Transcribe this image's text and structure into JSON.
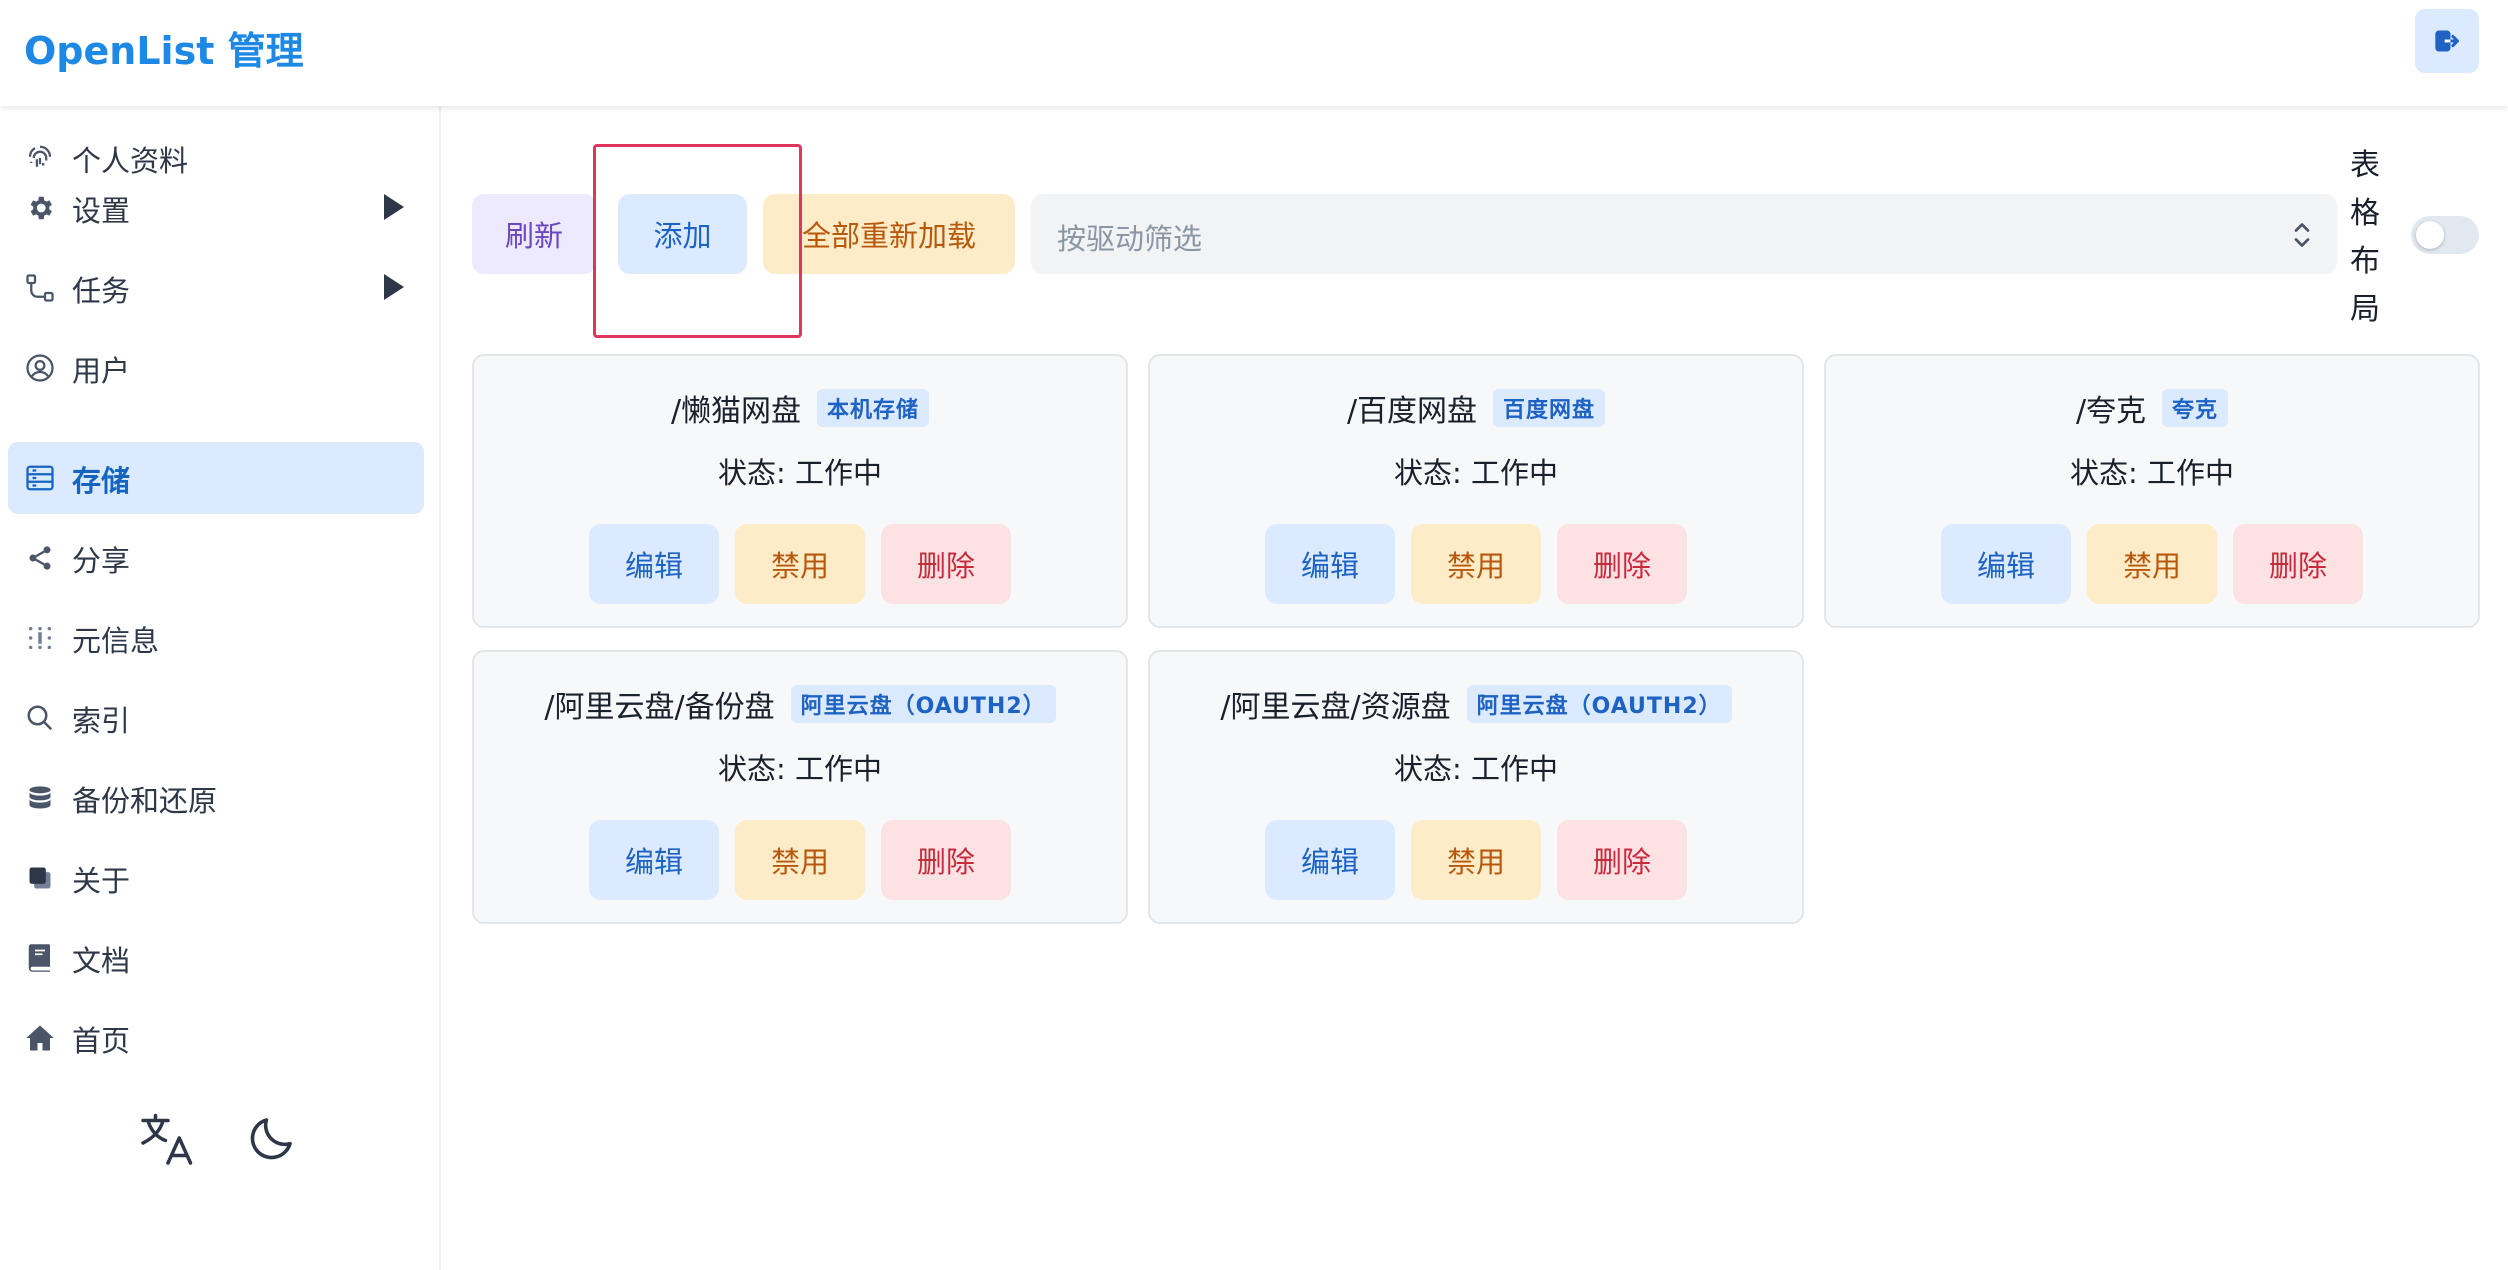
{
  "header": {
    "title": "OpenList 管理",
    "logout_icon": "logout-icon"
  },
  "sidebar": {
    "items": [
      {
        "label": "个人资料",
        "icon": "fingerprint-icon"
      },
      {
        "label": "设置",
        "icon": "gear-icon",
        "expandable": true
      },
      {
        "label": "任务",
        "icon": "workflow-icon",
        "expandable": true
      },
      {
        "label": "用户",
        "icon": "user-circle-icon"
      },
      {
        "label": "存储",
        "icon": "storage-icon",
        "active": true
      },
      {
        "label": "分享",
        "icon": "share-icon"
      },
      {
        "label": "元信息",
        "icon": "metadata-icon"
      },
      {
        "label": "索引",
        "icon": "search-icon"
      },
      {
        "label": "备份和还原",
        "icon": "database-icon"
      },
      {
        "label": "关于",
        "icon": "copy-icon"
      },
      {
        "label": "文档",
        "icon": "book-icon"
      },
      {
        "label": "首页",
        "icon": "home-icon"
      }
    ],
    "bottom": {
      "language_icon": "translate-icon",
      "theme_icon": "moon-icon"
    }
  },
  "toolbar": {
    "refresh_label": "刷新",
    "add_label": "添加",
    "reload_all_label": "全部重新加载",
    "filter_placeholder": "按驱动筛选",
    "layout_label_chars": [
      "表",
      "格",
      "布",
      "局"
    ],
    "table_layout_enabled": false
  },
  "storages": [
    {
      "path": "/懒猫网盘",
      "driver": "本机存储",
      "status": "状态: 工作中"
    },
    {
      "path": "/百度网盘",
      "driver": "百度网盘",
      "status": "状态: 工作中"
    },
    {
      "path": "/夸克",
      "driver": "夸克",
      "status": "状态: 工作中"
    },
    {
      "path": "/阿里云盘/备份盘",
      "driver": "阿里云盘（OAUTH2）",
      "status": "状态: 工作中"
    },
    {
      "path": "/阿里云盘/资源盘",
      "driver": "阿里云盘（OAUTH2）",
      "status": "状态: 工作中"
    }
  ],
  "card_actions": {
    "edit": "编辑",
    "disable": "禁用",
    "delete": "删除"
  },
  "colors": {
    "brand": "#1e88e5",
    "active_bg": "#dbeafe",
    "highlight": "#e0365e"
  }
}
